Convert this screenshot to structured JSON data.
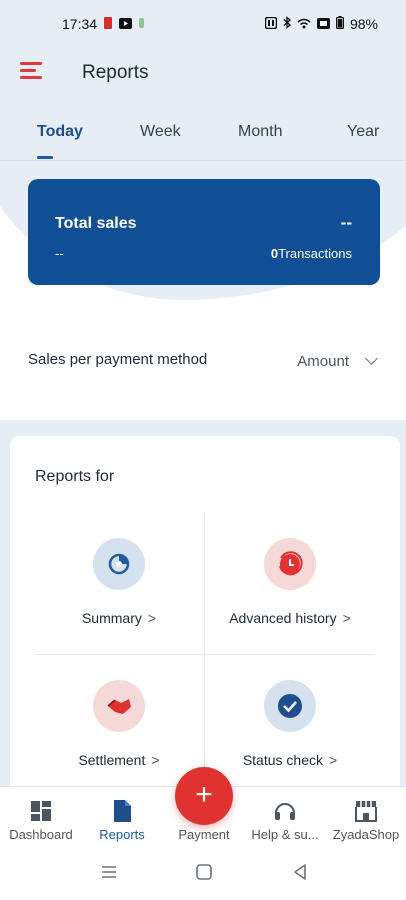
{
  "status_bar": {
    "time": "17:34",
    "battery": "98%"
  },
  "header": {
    "title": "Reports",
    "tabs": [
      {
        "label": "Today",
        "active": true
      },
      {
        "label": "Week",
        "active": false
      },
      {
        "label": "Month",
        "active": false
      },
      {
        "label": "Year",
        "active": false
      }
    ]
  },
  "sales_card": {
    "title": "Total sales",
    "value": "--",
    "sub_value": "--",
    "transactions_count": "0",
    "transactions_label": "Transactions"
  },
  "payment_method": {
    "label": "Sales per payment method",
    "selected": "Amount"
  },
  "reports": {
    "heading": "Reports for",
    "items": [
      {
        "label": "Summary",
        "icon": "summary-icon"
      },
      {
        "label": "Advanced history",
        "icon": "advanced-history-icon"
      },
      {
        "label": "Settlement",
        "icon": "settlement-icon"
      },
      {
        "label": "Status check",
        "icon": "status-check-icon"
      }
    ]
  },
  "bottom_nav": {
    "items": [
      {
        "label": "Dashboard",
        "icon": "dashboard-icon"
      },
      {
        "label": "Reports",
        "icon": "reports-icon"
      },
      {
        "label": "Payment",
        "icon": "plus-icon"
      },
      {
        "label": "Help & su...",
        "icon": "headset-icon"
      },
      {
        "label": "ZyadaShop",
        "icon": "shop-icon"
      }
    ]
  },
  "colors": {
    "primary": "#104f95",
    "accent": "#e03331",
    "background_tint": "#e7edf4"
  }
}
